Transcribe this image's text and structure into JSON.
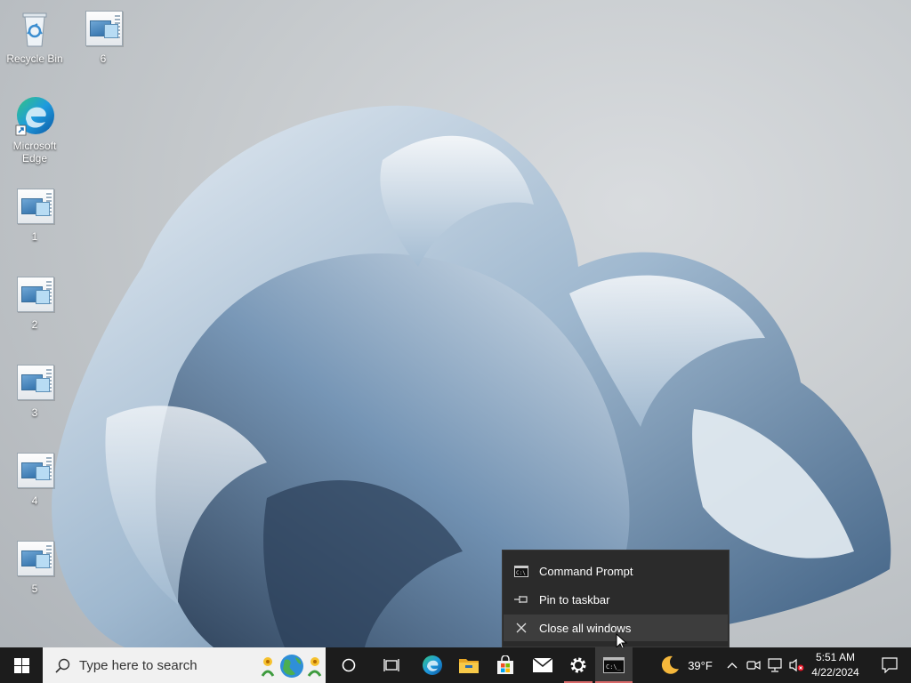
{
  "desktop": {
    "icons": [
      {
        "label": "Recycle Bin"
      },
      {
        "label": "6"
      },
      {
        "label": "Microsoft Edge"
      },
      {
        "label": "1"
      },
      {
        "label": "2"
      },
      {
        "label": "3"
      },
      {
        "label": "4"
      },
      {
        "label": "5"
      }
    ]
  },
  "jumplist": {
    "items": [
      {
        "label": "Command Prompt",
        "icon": "cmd-icon"
      },
      {
        "label": "Pin to taskbar",
        "icon": "pin-icon"
      },
      {
        "label": "Close all windows",
        "icon": "close-icon"
      }
    ]
  },
  "taskbar": {
    "search_placeholder": "Type here to search",
    "apps": [
      "cortana-icon",
      "task-view-icon",
      "edge-icon",
      "file-explorer-icon",
      "store-icon",
      "mail-icon",
      "settings-icon",
      "command-prompt-icon"
    ],
    "weather": {
      "temp": "39°F",
      "icon": "moon-icon"
    },
    "tray_icons": [
      "chevron-up-icon",
      "meet-now-icon",
      "network-icon",
      "volume-muted-icon"
    ],
    "clock": {
      "time": "5:51 AM",
      "date": "4/22/2024"
    },
    "colors": {
      "background": "#1c1c1c",
      "accent_running": "#d86a6a",
      "menu_background": "#2b2b2b"
    }
  }
}
